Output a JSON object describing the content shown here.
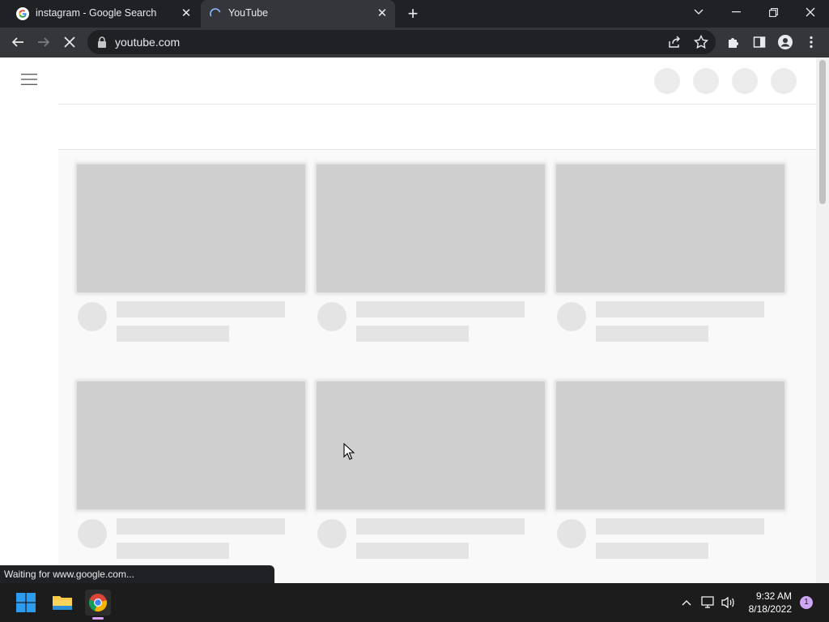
{
  "browser": {
    "tabs": [
      {
        "title": "instagram - Google Search",
        "favicon": "google-icon"
      },
      {
        "title": "YouTube",
        "favicon": "loading-spinner-icon"
      }
    ],
    "url": "youtube.com",
    "status_text": "Waiting for www.google.com..."
  },
  "taskbar": {
    "time": "9:32 AM",
    "date": "8/18/2022",
    "notification_count": "1"
  },
  "colors": {
    "tab_bar": "#202124",
    "toolbar": "#35363a",
    "page_bg": "#f9f9f9",
    "skeleton_thumb": "#cfcfcf",
    "skeleton_line": "#e4e4e4"
  },
  "skeleton": {
    "header_placeholders": 4,
    "rows": 2,
    "cards_per_row": 3
  }
}
